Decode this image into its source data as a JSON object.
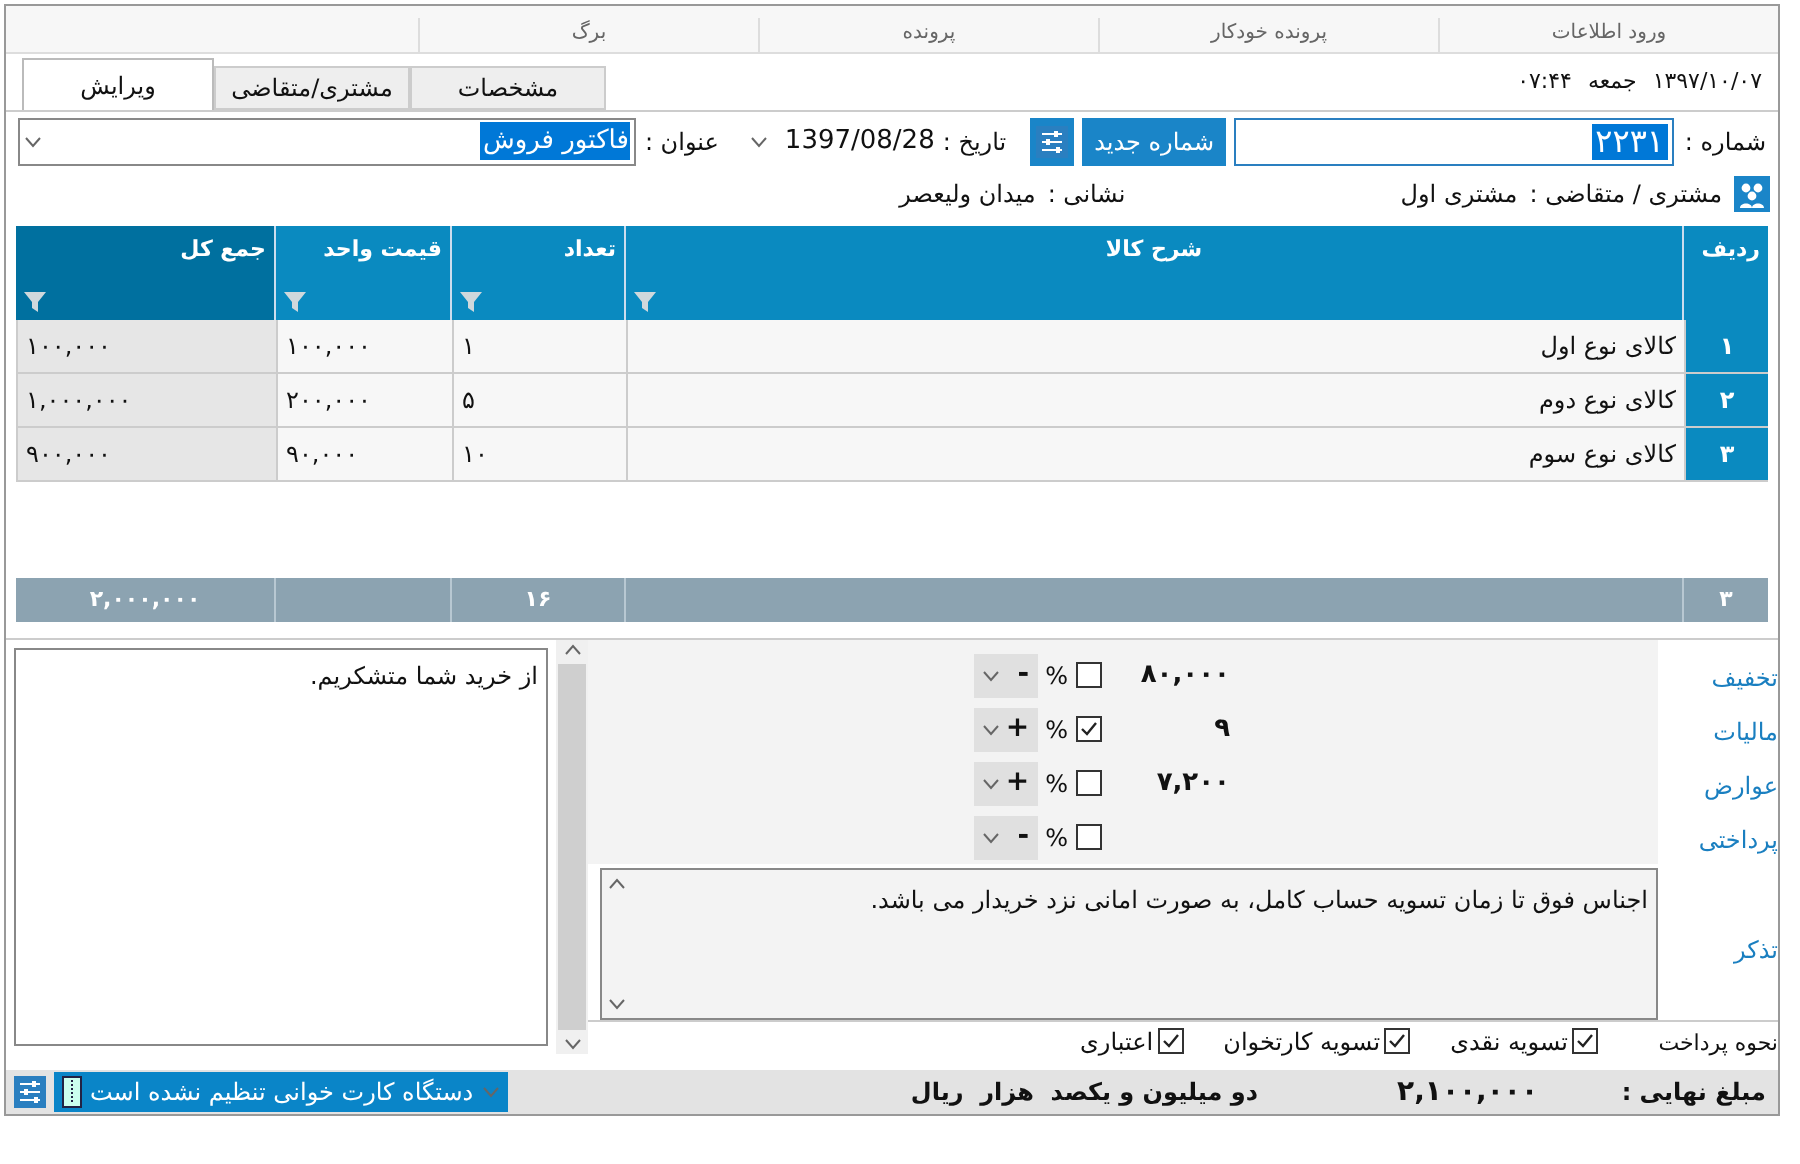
{
  "menu": [
    {
      "label": "ورود اطلاعات"
    },
    {
      "label": "پرونده خودکار"
    },
    {
      "label": "پرونده"
    },
    {
      "label": "برگ"
    }
  ],
  "datetime": {
    "date": "۱۳۹۷/۱۰/۰۷",
    "day": "جمعه",
    "time": "۰۷:۴۴"
  },
  "tabs": [
    {
      "label": "مشخصات",
      "selected": false
    },
    {
      "label": "مشتری/متقاضی",
      "selected": false
    },
    {
      "label": "ویرایش",
      "selected": true
    }
  ],
  "header": {
    "number_label": "شماره :",
    "number": "۲۲۳۱",
    "new_number_button": "شماره جدید",
    "date_label": "تاریخ :",
    "date": "1397/08/28",
    "title_label": "عنوان :",
    "title": "فاکتور فروش"
  },
  "customer": {
    "label": "مشتری / متقاضی :",
    "name": "مشتری اول",
    "address_label": "نشانی :",
    "address": "میدان ولیعصر"
  },
  "table": {
    "columns": [
      "ردیف",
      "شرح کالا",
      "تعداد",
      "قیمت واحد",
      "جمع کل"
    ],
    "rows": [
      {
        "index": "۱",
        "description": "کالای نوع اول",
        "quantity": "۱",
        "unit_price": "۱۰۰,۰۰۰",
        "total": "۱۰۰,۰۰۰"
      },
      {
        "index": "۲",
        "description": "کالای نوع دوم",
        "quantity": "۵",
        "unit_price": "۲۰۰,۰۰۰",
        "total": "۱,۰۰۰,۰۰۰"
      },
      {
        "index": "۳",
        "description": "کالای نوع سوم",
        "quantity": "۱۰",
        "unit_price": "۹۰,۰۰۰",
        "total": "۹۰۰,۰۰۰"
      }
    ],
    "footer": {
      "count": "۳",
      "quantity": "۱۶",
      "total": "۲,۰۰۰,۰۰۰"
    }
  },
  "adjustments": [
    {
      "label": "تخفیف",
      "value": "۸۰,۰۰۰",
      "unit": "%",
      "percent": false,
      "sign": "-"
    },
    {
      "label": "مالیات",
      "value": "۹",
      "unit": "%",
      "percent": true,
      "sign": "+"
    },
    {
      "label": "عوارض",
      "value": "۷,۲۰۰",
      "unit": "%",
      "percent": false,
      "sign": "+"
    },
    {
      "label": "پرداختی",
      "unit": "%",
      "percent": false,
      "sign": "-"
    }
  ],
  "note": {
    "label": "تذکر",
    "text": "اجناس فوق تا زمان تسویه حساب کامل، به صورت امانی نزد خریدار می باشد."
  },
  "payment": {
    "label": "نحوه پرداخت",
    "options": [
      {
        "label": "تسویه نقدی",
        "checked": true
      },
      {
        "label": "تسویه کارتخوان",
        "checked": true
      },
      {
        "label": "اعتباری",
        "checked": true
      }
    ]
  },
  "message": {
    "text": "از خرید شما متشکریم."
  },
  "card_reader": {
    "status": "دستگاه کارت خوانی تنظیم نشده است"
  },
  "total": {
    "label": "مبلغ نهایی :",
    "amount": "۲,۱۰۰,۰۰۰",
    "words": "دو میلیون و یکصد  هزار  ریال"
  }
}
